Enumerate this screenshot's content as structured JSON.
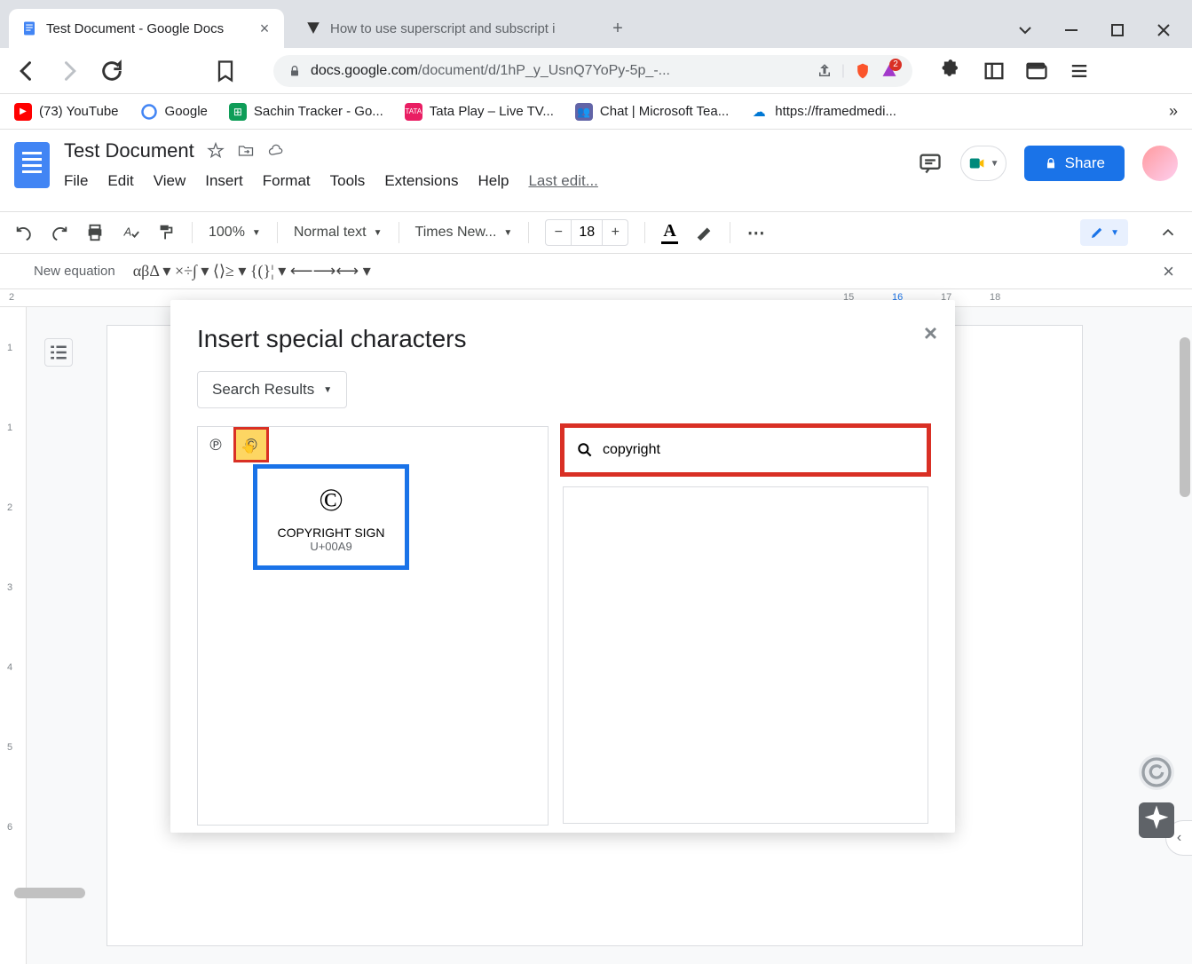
{
  "browser": {
    "tabs": [
      {
        "title": "Test Document - Google Docs",
        "active": true
      },
      {
        "title": "How to use superscript and subscript i",
        "active": false
      }
    ],
    "url_dark": "docs.google.com",
    "url_rest": "/document/d/1hP_y_UsnQ7YoPy-5p_-...",
    "bookmarks": [
      {
        "label": "(73) YouTube"
      },
      {
        "label": "Google"
      },
      {
        "label": "Sachin Tracker - Go..."
      },
      {
        "label": "Tata Play – Live TV..."
      },
      {
        "label": "Chat | Microsoft Tea..."
      },
      {
        "label": "https://framedmedi..."
      }
    ]
  },
  "docs": {
    "title": "Test Document",
    "menus": [
      "File",
      "Edit",
      "View",
      "Insert",
      "Format",
      "Tools",
      "Extensions",
      "Help"
    ],
    "last_edit": "Last edit...",
    "share_label": "Share",
    "toolbar": {
      "zoom": "100%",
      "style": "Normal text",
      "font": "Times New...",
      "font_size": "18"
    },
    "equation_label": "New equation",
    "equation_symbols": "αβΔ ▾   ×÷∫ ▾   ⟨⟩≥ ▾   {(}¦ ▾   ⟵⟶⟷ ▾"
  },
  "ruler_h": [
    "2",
    "15",
    "16",
    "17",
    "18"
  ],
  "ruler_v": [
    "1",
    "1",
    "2",
    "3",
    "4",
    "5",
    "6"
  ],
  "dialog": {
    "title": "Insert special characters",
    "filter_label": "Search Results",
    "search_value": "copyright",
    "results": [
      {
        "char": "℗"
      },
      {
        "char": "©"
      }
    ],
    "tooltip": {
      "char": "©",
      "name": "COPYRIGHT SIGN",
      "code": "U+00A9"
    }
  }
}
